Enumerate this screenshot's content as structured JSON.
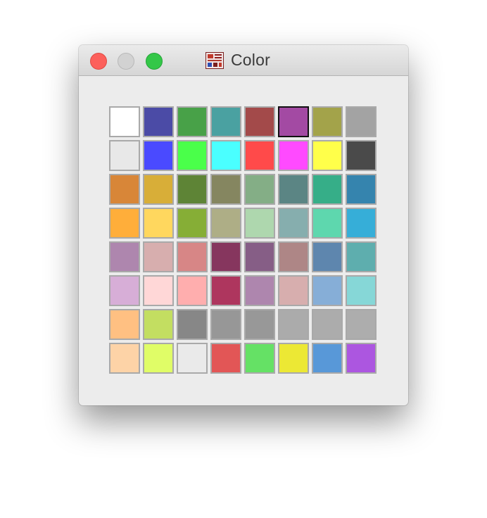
{
  "window": {
    "title": "Color",
    "app_icon": "color-palette-app-icon",
    "controls": {
      "close": "close-button",
      "minimize": "minimize-button",
      "zoom": "zoom-button"
    }
  },
  "palette": {
    "selected_index": 5,
    "columns": 8,
    "rows": 8,
    "colors": [
      "#ffffff",
      "#4b4ba6",
      "#48a148",
      "#4aa1a1",
      "#a34a4a",
      "#a34aa3",
      "#a3a34a",
      "#a3a3a3",
      "#e8e8e8",
      "#4a4aff",
      "#4aff4a",
      "#4affff",
      "#ff4a4a",
      "#ff4aff",
      "#ffff4a",
      "#4a4a4a",
      "#d88638",
      "#d8ae38",
      "#5e8436",
      "#858660",
      "#84ae86",
      "#5b8584",
      "#36ae88",
      "#3584ae",
      "#ffae3a",
      "#ffd75e",
      "#86ae36",
      "#aeae86",
      "#aed7ae",
      "#86aeae",
      "#5ed7ae",
      "#36aed8",
      "#ae86ae",
      "#d7aeae",
      "#d78686",
      "#86365e",
      "#865e86",
      "#ae8686",
      "#5e86ae",
      "#5eaeae",
      "#d7aed7",
      "#ffd7d7",
      "#ffaeae",
      "#ae365e",
      "#ae86ae",
      "#d7aeae",
      "#86aed7",
      "#86d7d7",
      "#ffc082",
      "#c3de61",
      "#878787",
      "#979797",
      "#989898",
      "#ababab",
      "#acacac",
      "#adadad",
      "#fdd3a7",
      "#e0fd67",
      "#eaeaea",
      "#e25656",
      "#65e165",
      "#ece834",
      "#5898d8",
      "#ac56e0"
    ]
  }
}
